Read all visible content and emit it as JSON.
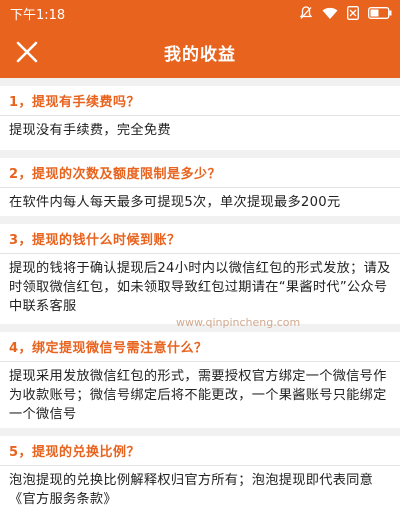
{
  "status_bar": {
    "time": "下午1:18",
    "icons": [
      "mute-icon",
      "signal-off-icon",
      "wifi-icon",
      "sim-none-icon",
      "battery-icon"
    ],
    "color": "#e8631e"
  },
  "header": {
    "title": "我的收益",
    "close_icon": "close-icon"
  },
  "faq": [
    {
      "question": "1，提现有手续费吗？",
      "answer": "提现没有手续费，完全免费"
    },
    {
      "question": "2，提现的次数及额度限制是多少？",
      "answer": "在软件内每人每天最多可提现5次，单次提现最多200元"
    },
    {
      "question": "3，提现的钱什么时候到账？",
      "answer": "提现的钱将于确认提现后24小时内以微信红包的形式发放；请及时领取微信红包，如未领取导致红包过期请在“果酱时代”公众号中联系客服"
    },
    {
      "question": "4，绑定提现微信号需注意什么？",
      "answer": "提现采用发放微信红包的形式，需要授权官方绑定一个微信号作为收款账号；微信号绑定后将不能更改，一个果酱账号只能绑定一个微信号"
    },
    {
      "question": "5，提现的兑换比例？",
      "answer": "泡泡提现的兑换比例解释权归官方所有；泡泡提现即代表同意《官方服务条款》"
    }
  ],
  "watermark": "www.qinpincheng.com",
  "colors": {
    "accent": "#e8631e",
    "text": "#222222",
    "separator": "#f1f1f1"
  }
}
